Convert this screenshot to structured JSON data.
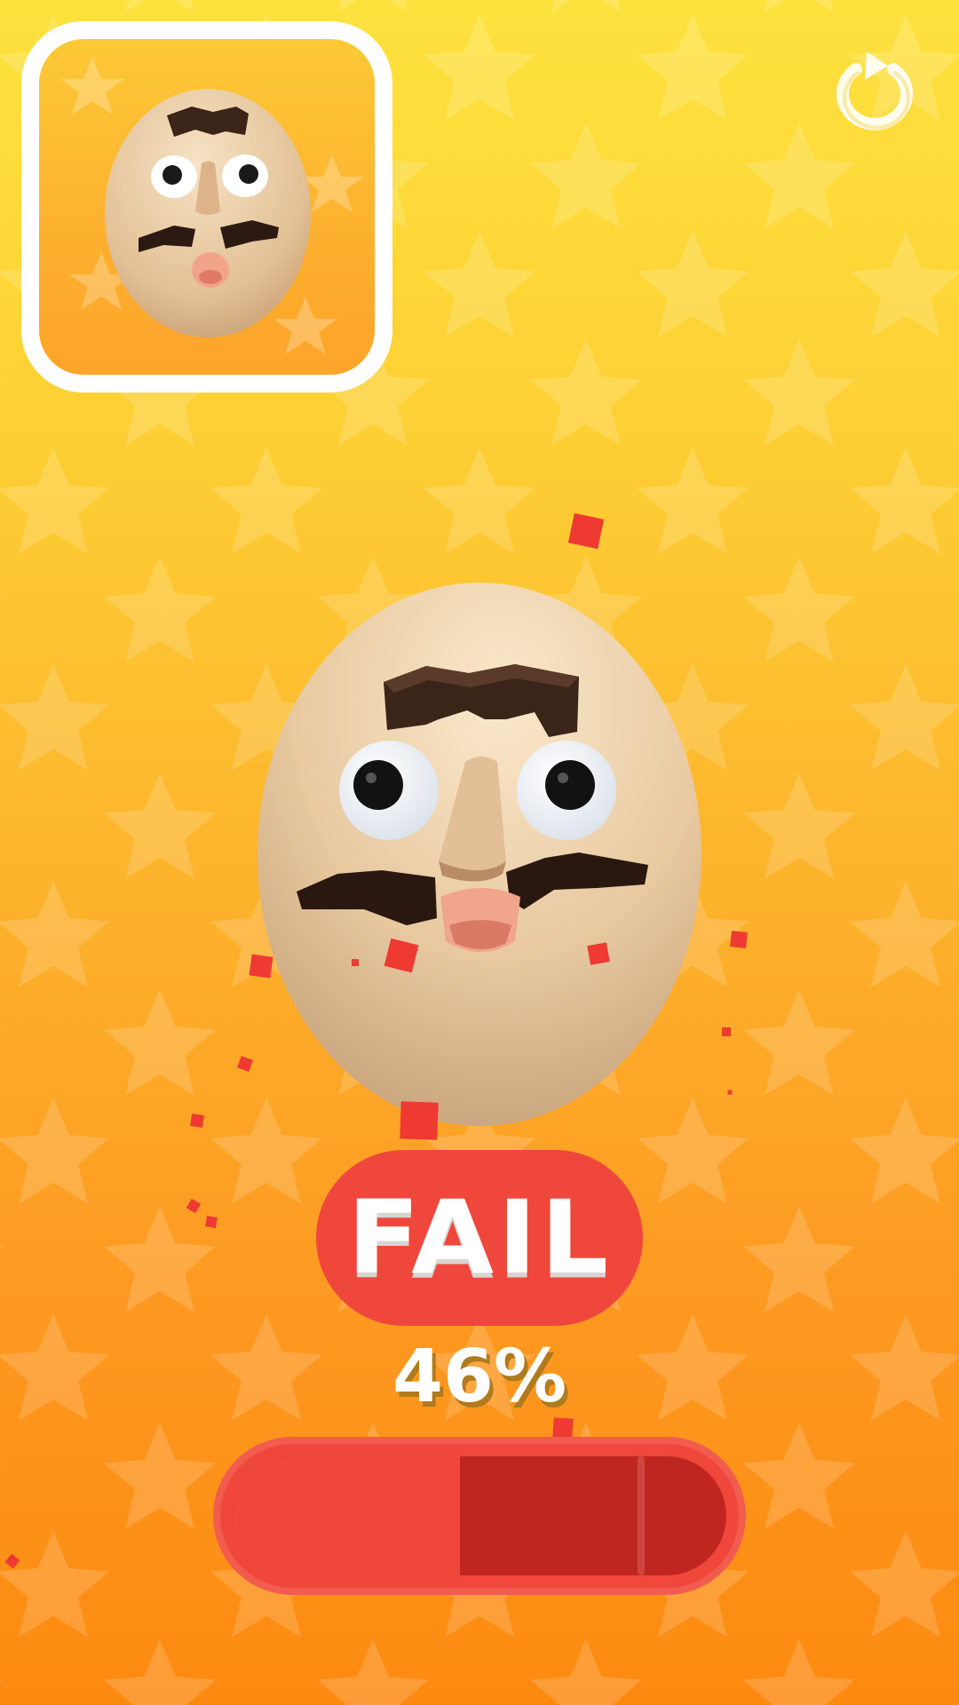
{
  "result": {
    "label": "FAIL",
    "percent_label": "46%",
    "progress": 0.46,
    "target_marker": 0.82
  },
  "icons": {
    "restart": "restart-icon"
  },
  "colors": {
    "background_top": "#fde23e",
    "background_bottom": "#fd8a10",
    "fail_red": "#f0473c",
    "track_dark_red": "#c02620",
    "card_border": "#ffffff",
    "skin": "#ecc9a0",
    "hair": "#3b2418"
  }
}
